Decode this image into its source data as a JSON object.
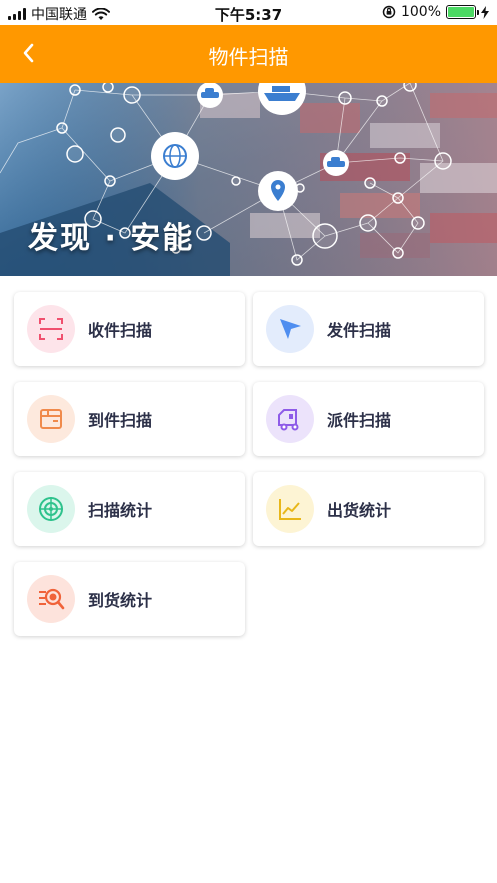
{
  "status_bar": {
    "carrier": "中国联通",
    "time": "下午5:37",
    "battery": "100%"
  },
  "nav": {
    "title": "物件扫描",
    "back_icon": "chevron-left-icon"
  },
  "banner": {
    "slogan": "发现 · 安能"
  },
  "menu": [
    {
      "label": "收件扫描",
      "icon": "scan-frame-icon",
      "bg": "#fde4ea",
      "color": "#f0506e"
    },
    {
      "label": "发件扫描",
      "icon": "send-arrow-icon",
      "bg": "#e3ecfc",
      "color": "#4f8ef0"
    },
    {
      "label": "到件扫描",
      "icon": "package-box-icon",
      "bg": "#fde9dd",
      "color": "#f08a4b"
    },
    {
      "label": "派件扫描",
      "icon": "delivery-truck-icon",
      "bg": "#ece3fb",
      "color": "#8e5be8"
    },
    {
      "label": "扫描统计",
      "icon": "radar-target-icon",
      "bg": "#dbf6ec",
      "color": "#2ec28c"
    },
    {
      "label": "出货统计",
      "icon": "line-chart-icon",
      "bg": "#fdf4d4",
      "color": "#e8b71a"
    },
    {
      "label": "到货统计",
      "icon": "search-list-icon",
      "bg": "#fde3dc",
      "color": "#f0633a"
    }
  ]
}
